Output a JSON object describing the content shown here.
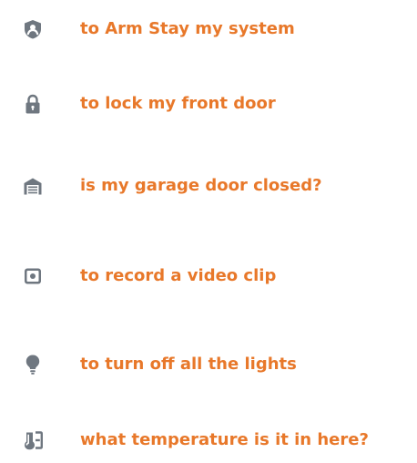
{
  "colors": {
    "accent": "#E8782A",
    "icon": "#6F7780"
  },
  "commands": [
    {
      "icon": "security-shield-icon",
      "label": "to Arm Stay my system"
    },
    {
      "icon": "lock-icon",
      "label": "to lock my front door"
    },
    {
      "icon": "garage-icon",
      "label": "is my garage door closed?"
    },
    {
      "icon": "camera-icon",
      "label": "to record a video clip"
    },
    {
      "icon": "light-bulb-icon",
      "label": "to turn off all the lights"
    },
    {
      "icon": "thermostat-icon",
      "label": "what temperature is it in here?"
    }
  ]
}
